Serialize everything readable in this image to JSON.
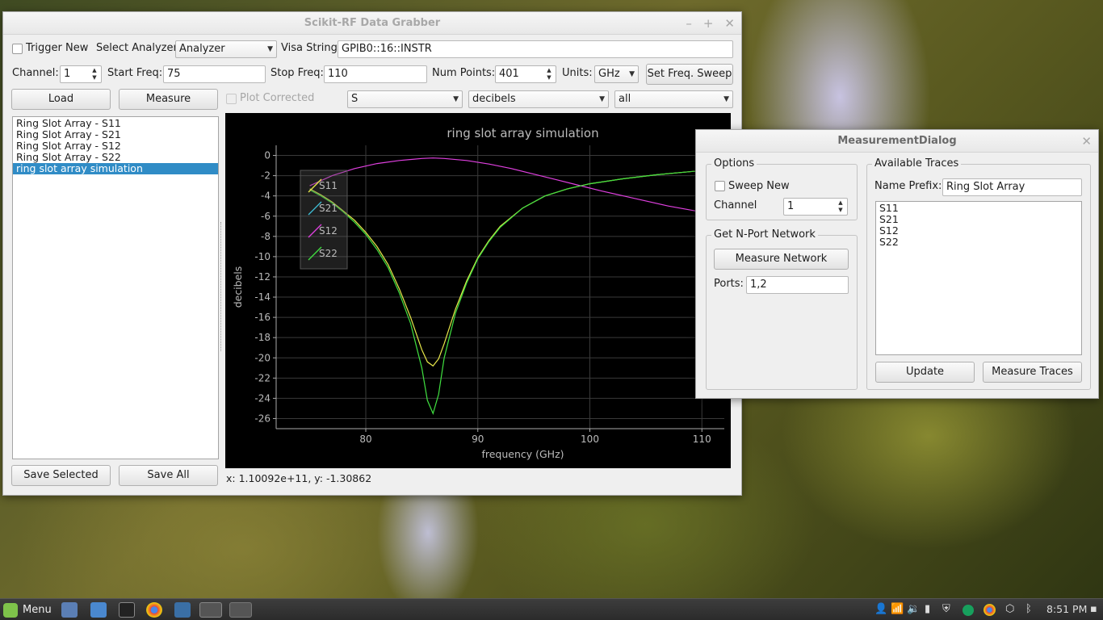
{
  "main_window": {
    "title": "Scikit-RF Data Grabber",
    "trigger_new_label": "Trigger New",
    "select_analyzer_label": "Select Analyzer",
    "analyzer_value": "Analyzer",
    "visa_label": "Visa String",
    "visa_value": "GPIB0::16::INSTR",
    "channel_label": "Channel:",
    "channel_value": "1",
    "start_freq_label": "Start Freq:",
    "start_freq_value": "75",
    "stop_freq_label": "Stop Freq:",
    "stop_freq_value": "110",
    "num_points_label": "Num Points:",
    "num_points_value": "401",
    "units_label": "Units:",
    "units_value": "GHz",
    "set_sweep_label": "Set Freq. Sweep",
    "load_label": "Load",
    "measure_label": "Measure",
    "plot_corrected_label": "Plot Corrected",
    "param_value": "S",
    "scale_value": "decibels",
    "traces_value": "all",
    "list_items": [
      "Ring Slot Array - S11",
      "Ring Slot Array - S21",
      "Ring Slot Array - S12",
      "Ring Slot Array - S22",
      "ring slot array simulation"
    ],
    "save_selected_label": "Save Selected",
    "save_all_label": "Save All",
    "status": "x: 1.10092e+11, y: -1.30862"
  },
  "chart_data": {
    "type": "line",
    "title": "ring slot array simulation",
    "xlabel": "frequency (GHz)",
    "ylabel": "decibels",
    "xlim": [
      72,
      112
    ],
    "ylim": [
      -27,
      1
    ],
    "x_ticks": [
      80,
      90,
      100,
      110
    ],
    "y_ticks": [
      0,
      -2,
      -4,
      -6,
      -8,
      -10,
      -12,
      -14,
      -16,
      -18,
      -20,
      -22,
      -24,
      -26
    ],
    "grid": true,
    "legend_position": "top-left",
    "background": "#000000",
    "series": [
      {
        "name": "S11",
        "color": "#e8e84a",
        "x": [
          75,
          76,
          77,
          78,
          79,
          80,
          81,
          82,
          83,
          84,
          85,
          85.5,
          86,
          86.5,
          87,
          88,
          89,
          90,
          91,
          92,
          94,
          96,
          98,
          100,
          103,
          106,
          108,
          110
        ],
        "y": [
          -3.3,
          -3.9,
          -4.6,
          -5.5,
          -6.4,
          -7.6,
          -9.0,
          -10.8,
          -13.2,
          -16.0,
          -19.2,
          -20.4,
          -20.8,
          -20.1,
          -18.6,
          -15.2,
          -12.4,
          -10.1,
          -8.4,
          -7.0,
          -5.2,
          -4.0,
          -3.3,
          -2.8,
          -2.3,
          -1.9,
          -1.7,
          -1.5
        ]
      },
      {
        "name": "S21",
        "color": "#3fc0d8",
        "x": [],
        "y": []
      },
      {
        "name": "S12",
        "color": "#e040e0",
        "x": [
          75,
          77,
          79,
          81,
          83,
          85,
          86,
          87,
          89,
          91,
          93,
          95,
          97,
          99,
          101,
          103,
          105,
          107,
          109,
          110
        ],
        "y": [
          -3.0,
          -2.0,
          -1.3,
          -0.8,
          -0.5,
          -0.3,
          -0.25,
          -0.3,
          -0.5,
          -0.85,
          -1.3,
          -1.85,
          -2.4,
          -2.95,
          -3.5,
          -4.0,
          -4.5,
          -5.0,
          -5.4,
          -5.6
        ]
      },
      {
        "name": "S22",
        "color": "#40e040",
        "x": [
          75,
          76,
          77,
          78,
          79,
          80,
          81,
          82,
          83,
          84,
          85,
          85.5,
          86,
          86.5,
          87,
          88,
          89,
          90,
          91,
          92,
          94,
          96,
          98,
          100,
          103,
          106,
          108,
          110
        ],
        "y": [
          -3.4,
          -4.0,
          -4.7,
          -5.6,
          -6.6,
          -7.8,
          -9.3,
          -11.1,
          -13.6,
          -16.6,
          -21.0,
          -24.2,
          -25.5,
          -23.6,
          -20.0,
          -15.6,
          -12.6,
          -10.2,
          -8.5,
          -7.1,
          -5.2,
          -4.0,
          -3.3,
          -2.8,
          -2.3,
          -1.9,
          -1.7,
          -1.5
        ]
      }
    ]
  },
  "dialog": {
    "title": "MeasurementDialog",
    "options_title": "Options",
    "sweep_new_label": "Sweep New",
    "channel_label": "Channel",
    "channel_value": "1",
    "nport_title": "Get N-Port Network",
    "measure_network_label": "Measure Network",
    "ports_label": "Ports:",
    "ports_value": "1,2",
    "traces_title": "Available Traces",
    "name_prefix_label": "Name Prefix:",
    "name_prefix_value": "Ring Slot Array",
    "traces": [
      "S11",
      "S21",
      "S12",
      "S22"
    ],
    "update_label": "Update",
    "measure_traces_label": "Measure Traces"
  },
  "taskbar": {
    "menu_label": "Menu",
    "clock": "8:51 PM",
    "launchers": [
      "show-desktop-icon",
      "files-icon",
      "terminal-icon",
      "chrome-icon",
      "python-icon",
      "app-window-icon",
      "app-window-2-icon"
    ]
  }
}
